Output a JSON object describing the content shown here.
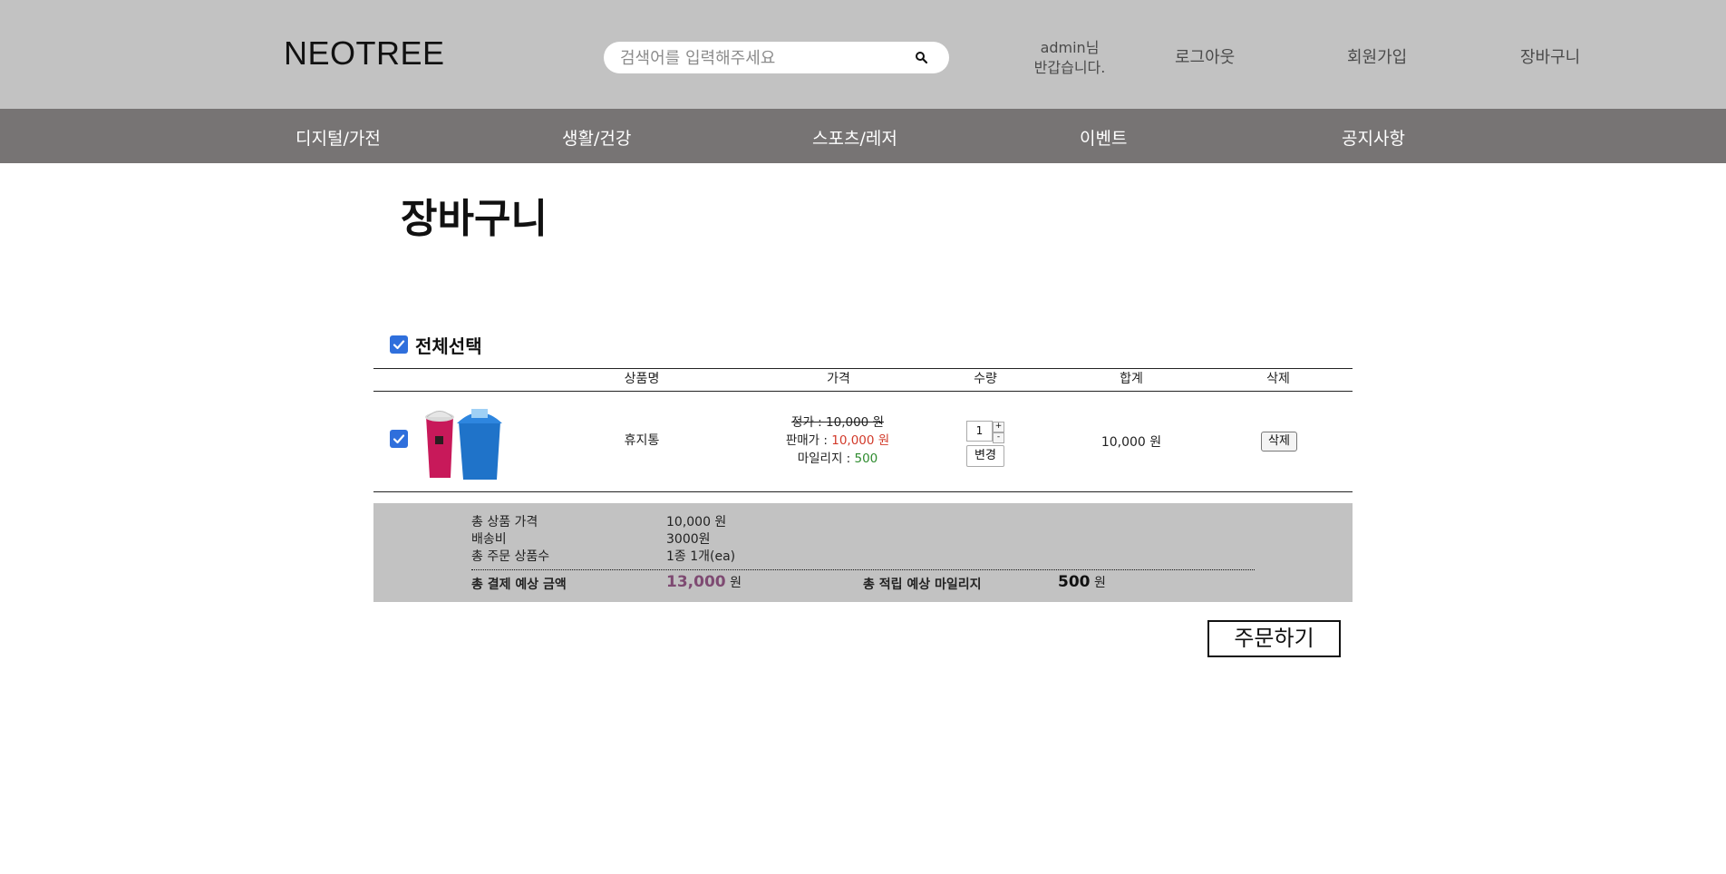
{
  "header": {
    "logo": "NEOTREE",
    "search_placeholder": "검색어를 입력해주세요",
    "greeting_line1": "admin님",
    "greeting_line2": "반갑습니다.",
    "links": [
      "로그아웃",
      "회원가입",
      "장바구니"
    ]
  },
  "nav": {
    "items": [
      "디지털/가전",
      "생활/건강",
      "스포츠/레저",
      "이벤트",
      "공지사항"
    ]
  },
  "page": {
    "title": "장바구니",
    "select_all_label": "전체선택",
    "select_all_checked": true
  },
  "table": {
    "headers": [
      "상품명",
      "가격",
      "수량",
      "합계",
      "삭제"
    ],
    "rows": [
      {
        "checked": true,
        "name": "휴지통",
        "list_price": "정가 : 10,000 원",
        "sale_label": "판매가 : ",
        "sale_value": "10,000 원",
        "mileage_label": "마일리지 : ",
        "mileage_value": "500",
        "quantity": "1",
        "qty_up": "+",
        "qty_down": "-",
        "change_label": "변경",
        "total": "10,000 원",
        "delete_label": "삭제"
      }
    ]
  },
  "summary": {
    "product_total_label": "총 상품 가격",
    "product_total_value": "10,000 원",
    "shipping_label": "배송비",
    "shipping_value": "3000원",
    "count_label": "총 주문 상품수",
    "count_value": "1종 1개(ea)",
    "pay_label": "총 결제 예상 금액",
    "pay_value": "13,000",
    "pay_unit": "원",
    "mileage_label": "총 적립 예상 마일리지",
    "mileage_value": "500",
    "mileage_unit": "원"
  },
  "order_button": "주문하기",
  "colors": {
    "header_bg": "#c2c2c2",
    "nav_bg": "#777474",
    "sale_red": "#d23a2a",
    "mileage_green": "#2e8b2e",
    "total_purple": "#7e4a72",
    "checkbox_blue": "#2f6fdc"
  }
}
